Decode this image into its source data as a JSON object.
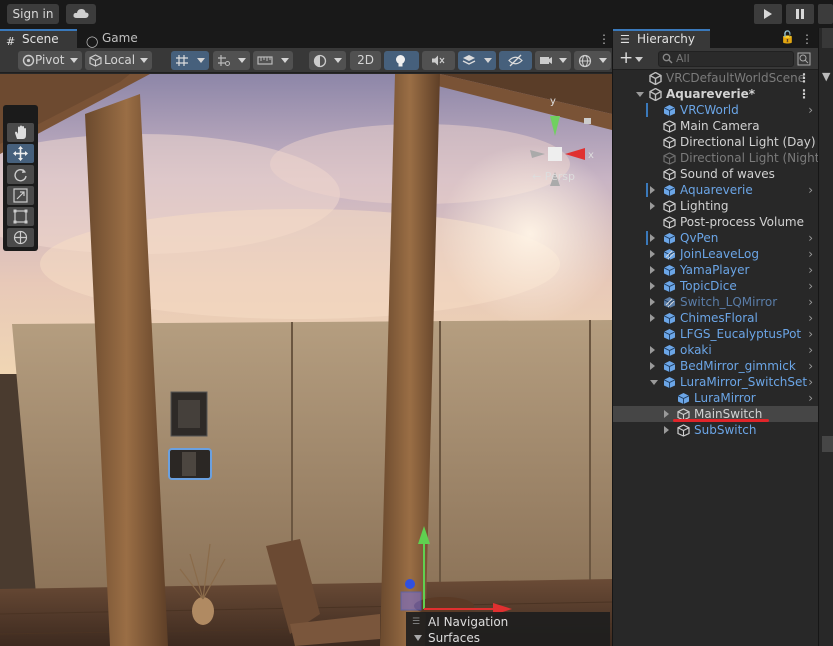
{
  "topbar": {
    "signin_label": "Sign in"
  },
  "scene": {
    "tabs": [
      {
        "label": "Scene"
      },
      {
        "label": "Game"
      }
    ],
    "toolbar": {
      "pivot_label": "Pivot",
      "local_label": "Local",
      "mode_2d_label": "2D"
    },
    "gizmo_label": "← Persp",
    "overlay": {
      "title": "AI Navigation",
      "item": "Surfaces"
    }
  },
  "hierarchy": {
    "tab_label": "Hierarchy",
    "search_placeholder": "All",
    "rows": [
      {
        "name": "VRCDefaultWorldScene",
        "style": "gray",
        "indent": 0,
        "fold": "none",
        "icon": "unity",
        "menu": true
      },
      {
        "name": "Aquareverie*",
        "style": "white-bold",
        "indent": 0,
        "fold": "open",
        "icon": "unity",
        "menu": true
      },
      {
        "name": "VRCWorld",
        "style": "blue",
        "indent": 1,
        "fold": "none",
        "icon": "cube-blue",
        "chevron": true,
        "bar": true
      },
      {
        "name": "Main Camera",
        "style": "white",
        "indent": 1,
        "fold": "none",
        "icon": "cube-white"
      },
      {
        "name": "Directional Light (Day)",
        "style": "white",
        "indent": 1,
        "fold": "none",
        "icon": "cube-white"
      },
      {
        "name": "Directional Light (Night)",
        "style": "gray",
        "indent": 1,
        "fold": "none",
        "icon": "cube-gray"
      },
      {
        "name": "Sound of waves",
        "style": "white",
        "indent": 1,
        "fold": "none",
        "icon": "cube-white"
      },
      {
        "name": "Aquareverie",
        "style": "blue",
        "indent": 1,
        "fold": "closed",
        "icon": "cube-blue",
        "chevron": true,
        "bar": true
      },
      {
        "name": "Lighting",
        "style": "white",
        "indent": 1,
        "fold": "closed",
        "icon": "cube-white"
      },
      {
        "name": "Post-process Volume",
        "style": "white",
        "indent": 1,
        "fold": "none",
        "icon": "cube-white"
      },
      {
        "name": "QvPen",
        "style": "blue",
        "indent": 1,
        "fold": "closed",
        "icon": "cube-blue",
        "chevron": true,
        "bar": true
      },
      {
        "name": "JoinLeaveLog",
        "style": "blue",
        "indent": 1,
        "fold": "closed",
        "icon": "cube-blue-striped",
        "chevron": true
      },
      {
        "name": "YamaPlayer",
        "style": "blue",
        "indent": 1,
        "fold": "closed",
        "icon": "cube-blue",
        "chevron": true
      },
      {
        "name": "TopicDice",
        "style": "blue",
        "indent": 1,
        "fold": "closed",
        "icon": "cube-blue",
        "chevron": true
      },
      {
        "name": "Switch_LQMirror",
        "style": "dimblue",
        "indent": 1,
        "fold": "closed",
        "icon": "cube-dim-striped",
        "chevron": true
      },
      {
        "name": "ChimesFloral",
        "style": "blue",
        "indent": 1,
        "fold": "closed",
        "icon": "cube-blue",
        "chevron": true
      },
      {
        "name": "LFGS_EucalyptusPot",
        "style": "blue",
        "indent": 1,
        "fold": "none",
        "icon": "cube-blue",
        "chevron": true
      },
      {
        "name": "okaki",
        "style": "blue",
        "indent": 1,
        "fold": "closed",
        "icon": "cube-blue",
        "chevron": true
      },
      {
        "name": "BedMirror_gimmick",
        "style": "blue",
        "indent": 1,
        "fold": "closed",
        "icon": "cube-blue",
        "chevron": true
      },
      {
        "name": "LuraMirror_SwitchSet",
        "style": "blue",
        "indent": 1,
        "fold": "open",
        "icon": "cube-blue",
        "chevron": true
      },
      {
        "name": "LuraMirror",
        "style": "blue",
        "indent": 2,
        "fold": "none",
        "icon": "cube-blue",
        "chevron": true
      },
      {
        "name": "MainSwitch",
        "style": "white",
        "indent": 2,
        "fold": "closed",
        "icon": "cube-white",
        "selected": true
      },
      {
        "name": "SubSwitch",
        "style": "blue",
        "indent": 2,
        "fold": "closed",
        "icon": "cube-white"
      }
    ]
  }
}
